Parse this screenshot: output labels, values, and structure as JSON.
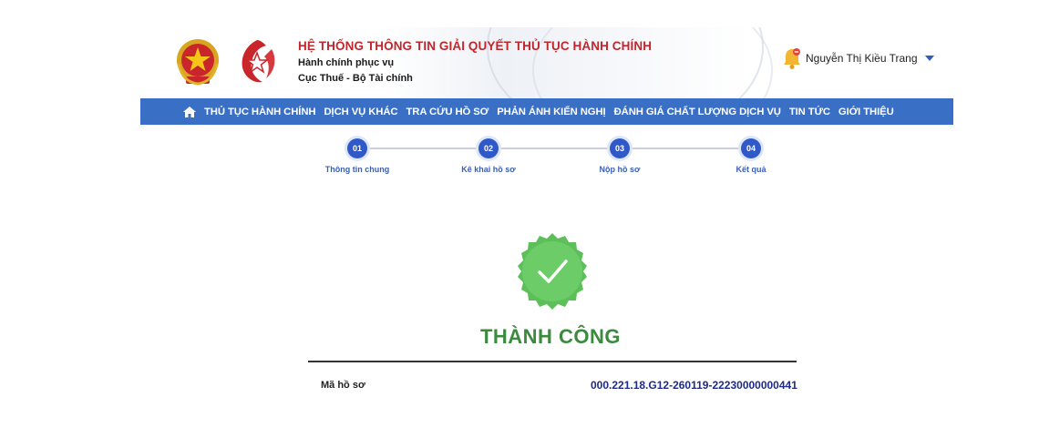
{
  "header": {
    "title": "HỆ THỐNG THÔNG TIN GIẢI QUYẾT THỦ TỤC HÀNH CHÍNH",
    "subtitle_line1": "Hành chính phục vụ",
    "subtitle_line2": "Cục Thuế - Bộ Tài chính",
    "user_name": "Nguyễn Thị Kiều Trang"
  },
  "nav": {
    "items": [
      "THỦ TỤC HÀNH CHÍNH",
      "DỊCH VỤ KHÁC",
      "TRA CỨU HỒ SƠ",
      "PHẢN ÁNH KIẾN NGHỊ",
      "ĐÁNH GIÁ CHẤT LƯỢNG DỊCH VỤ",
      "TIN TỨC",
      "GIỚI THIỆU"
    ]
  },
  "steps": [
    {
      "number": "01",
      "label": "Thông tin chung"
    },
    {
      "number": "02",
      "label": "Kê khai hồ sơ"
    },
    {
      "number": "03",
      "label": "Nộp hồ sơ"
    },
    {
      "number": "04",
      "label": "Kết quả"
    }
  ],
  "result": {
    "status": "THÀNH CÔNG",
    "record_label": "Mã hồ sơ",
    "record_value": "000.221.18.G12-260119-22230000000441"
  },
  "colors": {
    "nav_bg": "#3a6fc6",
    "title_red": "#c0272d",
    "step_blue": "#2f59c9",
    "success_green": "#3c8a3e",
    "record_blue": "#1e2a8a"
  },
  "icons": {
    "emblem": "national-emblem-icon",
    "logo": "star-logo-icon",
    "bell": "bell-icon",
    "home": "home-icon",
    "badge": "check-badge-icon"
  }
}
